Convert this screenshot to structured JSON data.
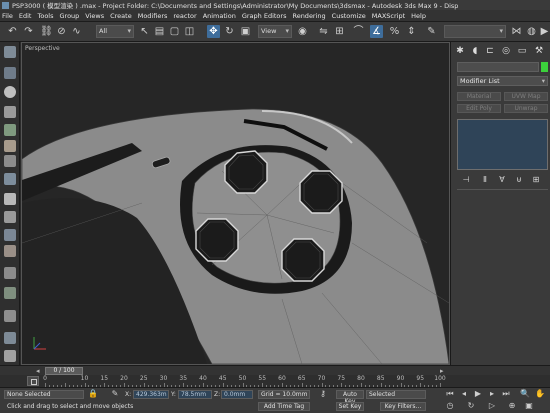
{
  "window": {
    "title": "PSP3000 ( 模型渲染 ) .max   -  Project Folder: C:\\Documents and Settings\\Administrator\\My Documents\\3dsmax    -  Autodesk 3ds Max 9      -  Disp"
  },
  "menu": [
    "File",
    "Edit",
    "Tools",
    "Group",
    "Views",
    "Create",
    "Modifiers",
    "reactor",
    "Animation",
    "Graph Editors",
    "Rendering",
    "Customize",
    "MAXScript",
    "Help"
  ],
  "toolbar": {
    "filter_value": "All",
    "coord_value": "View"
  },
  "viewport": {
    "label": "Perspective"
  },
  "command_panel": {
    "modifier_list": "Modifier List",
    "buttons": [
      "Material",
      "UVW Map",
      "Edit Poly",
      "Unwrap"
    ]
  },
  "time": {
    "slider_label": "0 / 100",
    "ticks": [
      "0",
      "10",
      "15",
      "20",
      "25",
      "30",
      "35",
      "40",
      "45",
      "50",
      "55",
      "60",
      "65",
      "70",
      "75",
      "80",
      "85",
      "90",
      "95",
      "100"
    ]
  },
  "status": {
    "selection": "None Selected",
    "prompt": "Click and drag to select and move objects",
    "x_label": "X:",
    "x_value": "429.363m",
    "y_label": "Y:",
    "y_value": "78.5mm",
    "z_label": "Z:",
    "z_value": "0.0mm",
    "grid": "Grid = 10.0mm",
    "add_time_tag": "Add Time Tag",
    "auto_key": "Auto Key",
    "auto_key_mode": "Selected",
    "set_key": "Set Key",
    "key_filters": "Key Filters..."
  }
}
